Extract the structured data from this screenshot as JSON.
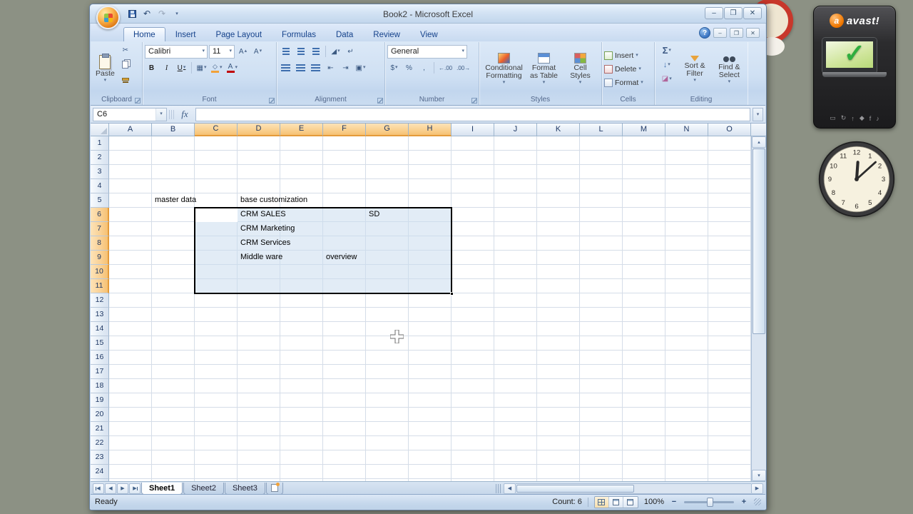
{
  "ui": {
    "dd": "▾",
    "up": "▴",
    "left": "◀",
    "right": "▶"
  },
  "titlebar": {
    "title": "Book2 - Microsoft Excel",
    "qat": {
      "undo": "↶",
      "redo": "↷",
      "more": "▾"
    },
    "controls": {
      "minimize": "–",
      "restore": "❐",
      "close": "✕"
    }
  },
  "ribbon": {
    "help": "?",
    "doc_controls": {
      "minimize": "–",
      "restore": "❐",
      "close": "✕"
    },
    "tabs": [
      {
        "label": "Home",
        "active": true
      },
      {
        "label": "Insert",
        "active": false
      },
      {
        "label": "Page Layout",
        "active": false
      },
      {
        "label": "Formulas",
        "active": false
      },
      {
        "label": "Data",
        "active": false
      },
      {
        "label": "Review",
        "active": false
      },
      {
        "label": "View",
        "active": false
      }
    ],
    "clipboard": {
      "paste_label": "Paste",
      "cut_icon": "✂",
      "group_label": "Clipboard"
    },
    "font": {
      "family": "Calibri",
      "size": "11",
      "bold": "B",
      "italic": "I",
      "underline": "U",
      "grow": "A",
      "shrink": "A",
      "borders_icon": "▦",
      "color_letter": "A",
      "group_label": "Font"
    },
    "alignment": {
      "orientation_icon": "◢",
      "wrap_icon": "↵",
      "indent_dec": "⇤",
      "indent_inc": "⇥",
      "merge_icon": "▣",
      "group_label": "Alignment"
    },
    "number": {
      "format": "General",
      "currency": "$",
      "percent": "%",
      "comma": ",",
      "inc_decimal": "←.00",
      "dec_decimal": ".00→",
      "group_label": "Number"
    },
    "styles": {
      "conditional": "Conditional Formatting",
      "format_table": "Format as Table",
      "cell_styles": "Cell Styles",
      "group_label": "Styles"
    },
    "cells": {
      "insert": "Insert",
      "delete": "Delete",
      "format": "Format",
      "group_label": "Cells"
    },
    "editing": {
      "autosum": "Σ",
      "fill_icon": "↓",
      "clear_icon": "◪",
      "sort_filter": "Sort & Filter",
      "find_select": "Find & Select",
      "group_label": "Editing"
    }
  },
  "formula_bar": {
    "name_box": "C6",
    "fx": "fx"
  },
  "grid": {
    "columns": [
      "A",
      "B",
      "C",
      "D",
      "E",
      "F",
      "G",
      "H",
      "I",
      "J",
      "K",
      "L",
      "M",
      "N",
      "O"
    ],
    "selected_columns": [
      "C",
      "D",
      "E",
      "F",
      "G",
      "H"
    ],
    "row_count": 25,
    "selected_rows": [
      6,
      7,
      8,
      9,
      10,
      11
    ],
    "cells": [
      {
        "ref": "B5",
        "col": "B",
        "row": 5,
        "text": "master data"
      },
      {
        "ref": "D5",
        "col": "D",
        "row": 5,
        "text": "base customization"
      },
      {
        "ref": "D6",
        "col": "D",
        "row": 6,
        "text": "CRM SALES"
      },
      {
        "ref": "G6",
        "col": "G",
        "row": 6,
        "text": "SD"
      },
      {
        "ref": "D7",
        "col": "D",
        "row": 7,
        "text": "CRM Marketing"
      },
      {
        "ref": "D8",
        "col": "D",
        "row": 8,
        "text": "CRM Services"
      },
      {
        "ref": "D9",
        "col": "D",
        "row": 9,
        "text": "Middle ware"
      },
      {
        "ref": "F9",
        "col": "F",
        "row": 9,
        "text": "overview"
      }
    ],
    "selection": {
      "range": "C6:H11",
      "active_cell": "C6"
    }
  },
  "sheet_bar": {
    "tabs": [
      {
        "label": "Sheet1",
        "active": true
      },
      {
        "label": "Sheet2",
        "active": false
      },
      {
        "label": "Sheet3",
        "active": false
      }
    ]
  },
  "status_bar": {
    "mode": "Ready",
    "count": "Count: 6",
    "zoom": "100%",
    "zoom_out": "−",
    "zoom_in": "+"
  },
  "gadgets": {
    "avast": {
      "brand": "avast!",
      "ball_letter": "a",
      "check": "✓",
      "toolbar_icons": [
        "▭",
        "↻",
        "↑",
        "◆",
        "f",
        "♪"
      ]
    },
    "clock": {
      "numbers": [
        "12",
        "1",
        "2",
        "3",
        "4",
        "5",
        "6",
        "7",
        "8",
        "9",
        "10",
        "11"
      ],
      "time": "12:08"
    }
  }
}
